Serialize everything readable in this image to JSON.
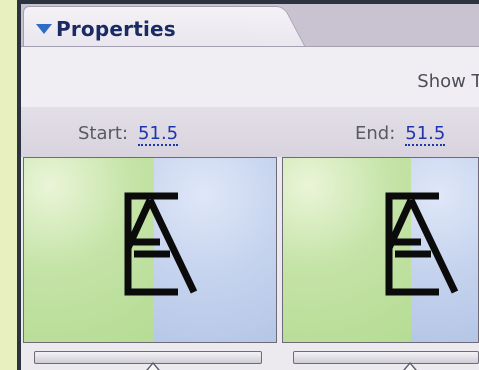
{
  "panel": {
    "title": "Properties",
    "collapse_icon": "triangle-down-icon"
  },
  "toolbar": {
    "show_tips_label": "Show Ti"
  },
  "keyframes": {
    "start": {
      "label": "Start:",
      "value": "51.5"
    },
    "end": {
      "label": "End:",
      "value": "51.5"
    }
  },
  "previews": [
    {
      "name": "start-preview",
      "glyph": "A-with-E-overlay"
    },
    {
      "name": "end-preview",
      "glyph": "A-with-E-overlay"
    }
  ],
  "colors": {
    "accent": "#1d36b0",
    "title": "#1a2b63",
    "preview_green": "#b9dd9a",
    "preview_blue": "#bccae9"
  }
}
